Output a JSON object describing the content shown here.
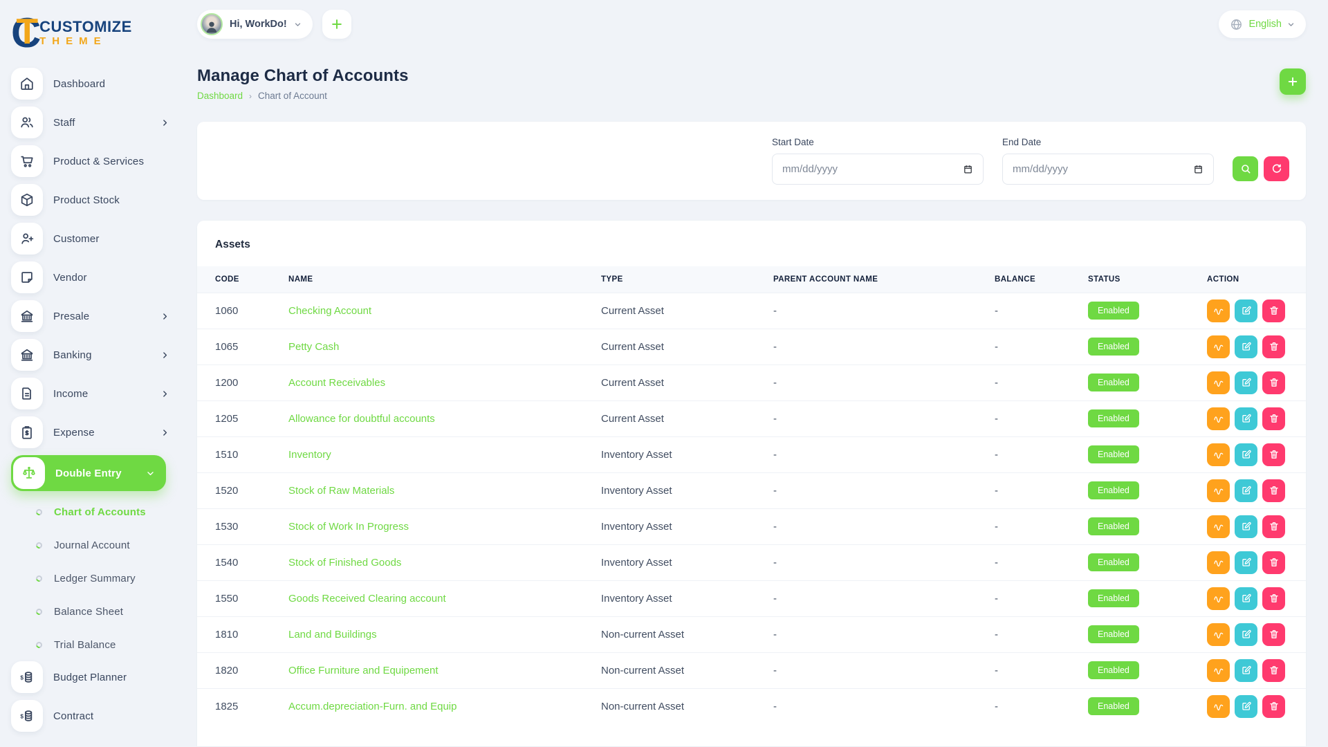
{
  "brand": {
    "monogram": "CT",
    "line1": "CUSTOMIZE",
    "line2": "THEME",
    "navy": "#17437d",
    "gold": "#f2a71b"
  },
  "header": {
    "greeting": "Hi, WorkDo!",
    "language": {
      "label": "English"
    }
  },
  "page": {
    "title": "Manage Chart of Accounts",
    "breadcrumb": [
      {
        "label": "Dashboard"
      },
      {
        "label": "Chart of Account"
      }
    ]
  },
  "filters": {
    "start_date": {
      "label": "Start Date",
      "placeholder": "mm/dd/yyyy"
    },
    "end_date": {
      "label": "End Date",
      "placeholder": "mm/dd/yyyy"
    }
  },
  "sidebar": {
    "items": [
      {
        "label": "Dashboard",
        "icon": "home-icon"
      },
      {
        "label": "Staff",
        "icon": "users-icon",
        "chevron": true
      },
      {
        "label": "Product & Services",
        "icon": "cart-icon"
      },
      {
        "label": "Product Stock",
        "icon": "package-icon"
      },
      {
        "label": "Customer",
        "icon": "user-plus-icon"
      },
      {
        "label": "Vendor",
        "icon": "note-icon"
      },
      {
        "label": "Presale",
        "icon": "bank-icon",
        "chevron": true
      },
      {
        "label": "Banking",
        "icon": "bank-icon",
        "chevron": true
      },
      {
        "label": "Income",
        "icon": "document-icon",
        "chevron": true
      },
      {
        "label": "Expense",
        "icon": "clipboard-dollar-icon",
        "chevron": true
      },
      {
        "label": "Double Entry",
        "icon": "scale-icon",
        "chevron": true,
        "active": true,
        "expanded": true,
        "children": [
          {
            "label": "Chart of Accounts",
            "active": true
          },
          {
            "label": "Journal Account"
          },
          {
            "label": "Ledger Summary"
          },
          {
            "label": "Balance Sheet"
          },
          {
            "label": "Trial Balance"
          }
        ]
      },
      {
        "label": "Budget Planner",
        "icon": "coins-icon"
      },
      {
        "label": "Contract",
        "icon": "coins-icon"
      }
    ]
  },
  "table": {
    "section_title": "Assets",
    "columns": [
      "CODE",
      "NAME",
      "TYPE",
      "PARENT ACCOUNT NAME",
      "BALANCE",
      "STATUS",
      "ACTION"
    ],
    "row_actions": [
      {
        "name": "transactions",
        "icon": "activity-wave-icon",
        "color": "#ffa21d"
      },
      {
        "name": "edit",
        "icon": "edit-icon",
        "color": "#3ec9d6"
      },
      {
        "name": "delete",
        "icon": "trash-icon",
        "color": "#ff3a6e"
      }
    ],
    "rows": [
      {
        "code": "1060",
        "name": "Checking Account",
        "type": "Current Asset",
        "parent": "-",
        "balance": "-",
        "status": "Enabled"
      },
      {
        "code": "1065",
        "name": "Petty Cash",
        "type": "Current Asset",
        "parent": "-",
        "balance": "-",
        "status": "Enabled"
      },
      {
        "code": "1200",
        "name": "Account Receivables",
        "type": "Current Asset",
        "parent": "-",
        "balance": "-",
        "status": "Enabled"
      },
      {
        "code": "1205",
        "name": "Allowance for doubtful accounts",
        "type": "Current Asset",
        "parent": "-",
        "balance": "-",
        "status": "Enabled"
      },
      {
        "code": "1510",
        "name": "Inventory",
        "type": "Inventory Asset",
        "parent": "-",
        "balance": "-",
        "status": "Enabled"
      },
      {
        "code": "1520",
        "name": "Stock of Raw Materials",
        "type": "Inventory Asset",
        "parent": "-",
        "balance": "-",
        "status": "Enabled"
      },
      {
        "code": "1530",
        "name": "Stock of Work In Progress",
        "type": "Inventory Asset",
        "parent": "-",
        "balance": "-",
        "status": "Enabled"
      },
      {
        "code": "1540",
        "name": "Stock of Finished Goods",
        "type": "Inventory Asset",
        "parent": "-",
        "balance": "-",
        "status": "Enabled"
      },
      {
        "code": "1550",
        "name": "Goods Received Clearing account",
        "type": "Inventory Asset",
        "parent": "-",
        "balance": "-",
        "status": "Enabled"
      },
      {
        "code": "1810",
        "name": "Land and Buildings",
        "type": "Non-current Asset",
        "parent": "-",
        "balance": "-",
        "status": "Enabled"
      },
      {
        "code": "1820",
        "name": "Office Furniture and Equipement",
        "type": "Non-current Asset",
        "parent": "-",
        "balance": "-",
        "status": "Enabled"
      },
      {
        "code": "1825",
        "name": "Accum.depreciation-Furn. and Equip",
        "type": "Non-current Asset",
        "parent": "-",
        "balance": "-",
        "status": "Enabled"
      }
    ]
  },
  "colors": {
    "primary_green": "#6fd943",
    "orange": "#ffa21d",
    "cyan": "#3ec9d6",
    "pink": "#ff3a6e",
    "body_bg": "#f0f3f8"
  }
}
